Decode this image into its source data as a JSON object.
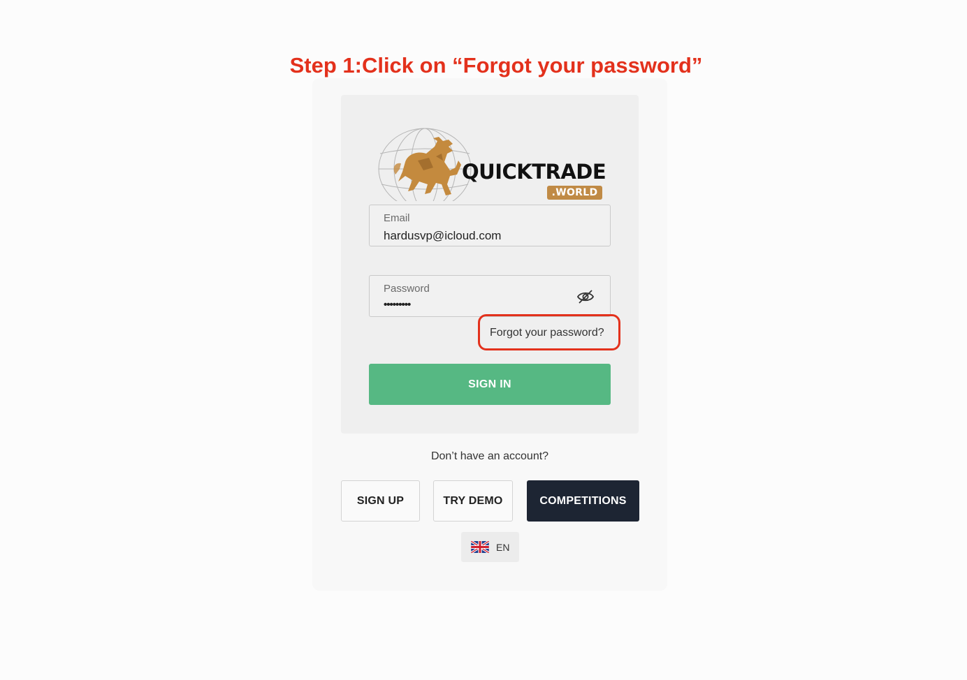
{
  "annotation": {
    "text": "Step 1:Click on “Forgot your password”"
  },
  "brand": {
    "name": "QUICKTRADE",
    "suffix": ".WORLD",
    "logo_icon": "bull-globe-logo-icon"
  },
  "login": {
    "email_label": "Email",
    "email_value": "hardusvp@icloud.com",
    "password_label": "Password",
    "password_value": "•••••••••",
    "visibility_icon": "eye-off-icon",
    "forgot_link": "Forgot your password?",
    "signin_label": "SIGN IN"
  },
  "footer": {
    "no_account": "Don’t have an account?",
    "signup_label": "SIGN UP",
    "demo_label": "TRY DEMO",
    "competitions_label": "COMPETITIONS",
    "language_code": "EN",
    "language_icon": "uk-flag-icon"
  },
  "colors": {
    "annotation": "#e3311c",
    "signin_button": "#56b883",
    "competitions_button": "#1d2533",
    "brand_accent": "#c08a45"
  }
}
